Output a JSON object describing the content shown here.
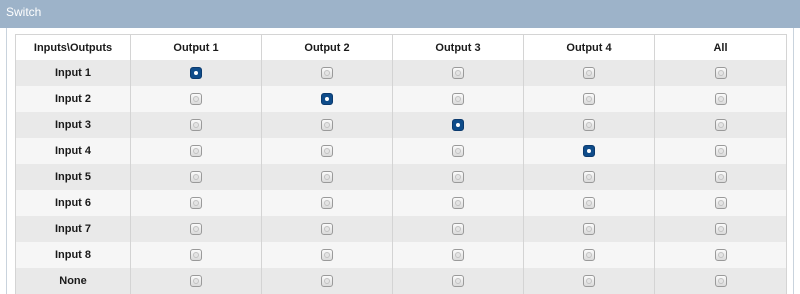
{
  "panel": {
    "title": "Switch"
  },
  "table": {
    "corner_header": "Inputs\\Outputs",
    "columns": [
      "Output 1",
      "Output 2",
      "Output 3",
      "Output 4",
      "All"
    ],
    "rows": [
      {
        "label": "Input 1",
        "selected_column": 0
      },
      {
        "label": "Input 2",
        "selected_column": 1
      },
      {
        "label": "Input 3",
        "selected_column": 2
      },
      {
        "label": "Input 4",
        "selected_column": 3
      },
      {
        "label": "Input 5",
        "selected_column": null
      },
      {
        "label": "Input 6",
        "selected_column": null
      },
      {
        "label": "Input 7",
        "selected_column": null
      },
      {
        "label": "Input 8",
        "selected_column": null
      },
      {
        "label": "None",
        "selected_column": null
      }
    ]
  },
  "colors": {
    "header_bar": "#9db3c9",
    "selected_radio": "#0f4c8a",
    "row_odd": "#e9e9e9",
    "row_even": "#f6f6f6"
  },
  "icons": {
    "radio_unselected": "radio-unselected-icon",
    "radio_selected": "radio-selected-icon"
  }
}
